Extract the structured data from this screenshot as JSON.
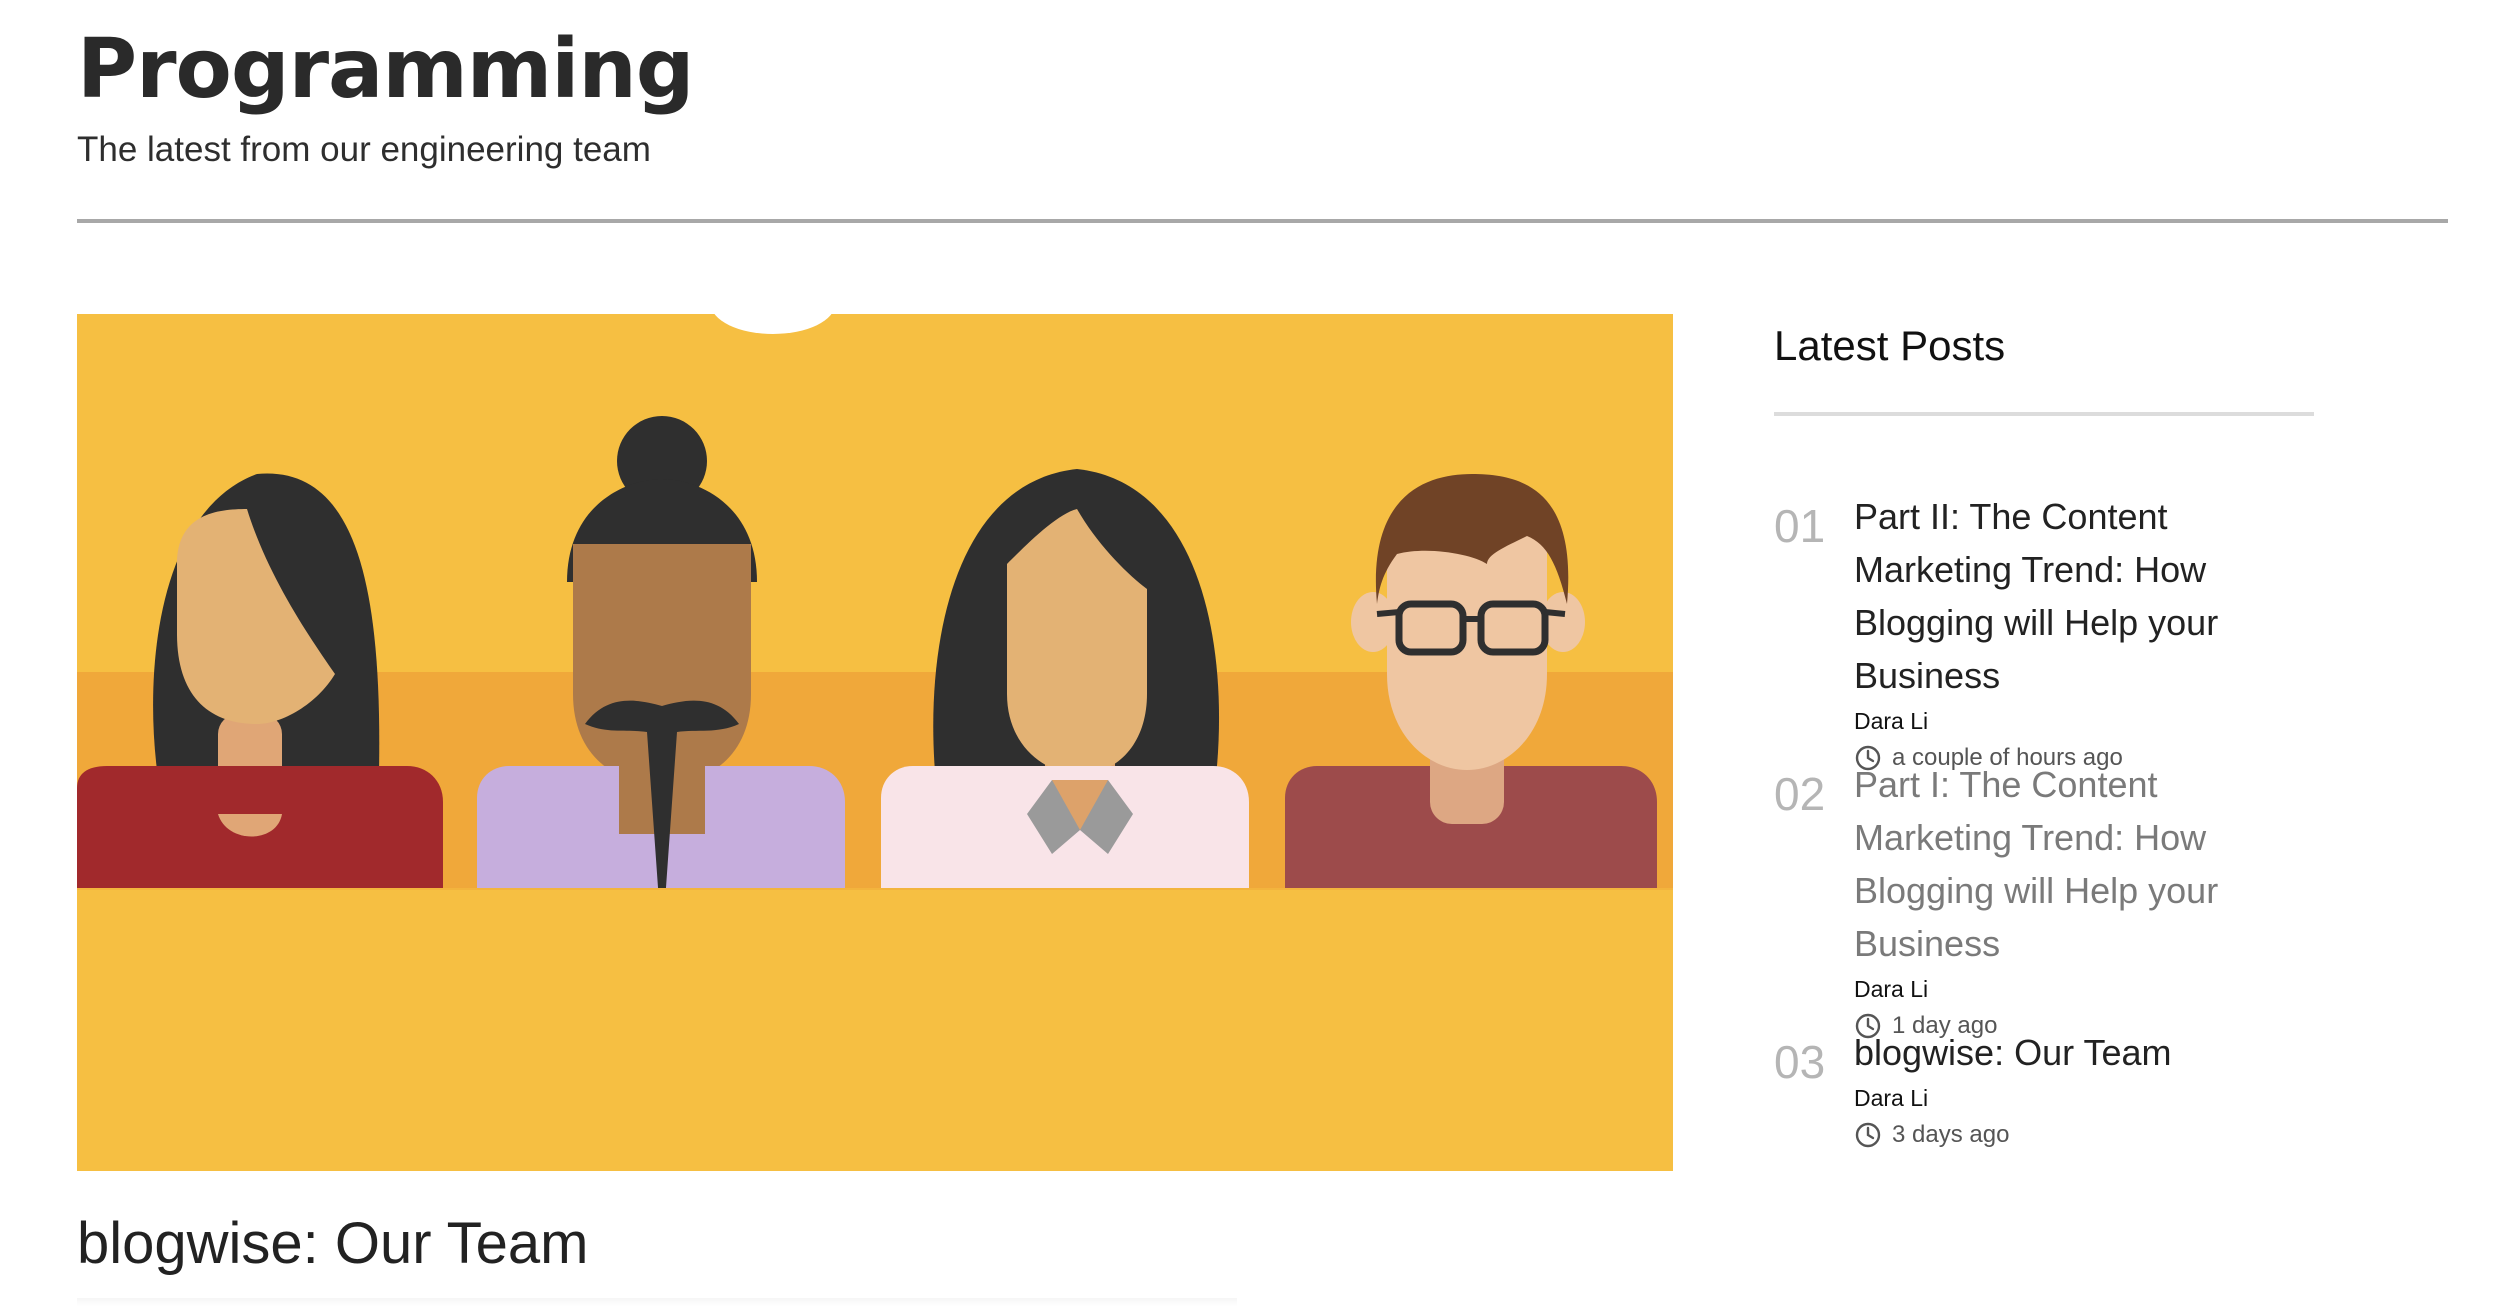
{
  "header": {
    "title": "Programming",
    "subtitle": "The latest from our engineering team"
  },
  "featured": {
    "title": "blogwise: Our Team",
    "image_icon": "team-illustration",
    "colors": {
      "background": "#F6BF42",
      "band": "#F0A83A"
    }
  },
  "sidebar": {
    "title": "Latest Posts",
    "posts": [
      {
        "number": "01",
        "title": "Part II: The Content Marketing Trend: How Blogging will Help your Business",
        "author": "Dara Li",
        "time": "a couple of hours ago"
      },
      {
        "number": "02",
        "title": "Part I: The Content Marketing Trend: How Blogging will Help your Business",
        "author": "Dara Li",
        "time": "1 day ago"
      },
      {
        "number": "03",
        "title": "blogwise: Our Team",
        "author": "Dara Li",
        "time": "3 days ago"
      }
    ]
  }
}
